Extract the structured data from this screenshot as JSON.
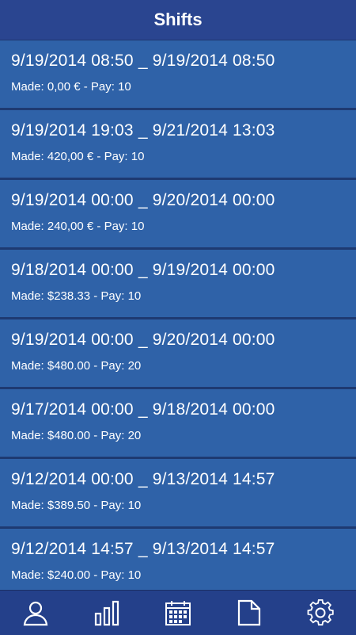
{
  "header": {
    "title": "Shifts"
  },
  "shifts": [
    {
      "range": "9/19/2014 08:50 _ 9/19/2014 08:50",
      "summary": "Made: 0,00 € - Pay: 10"
    },
    {
      "range": "9/19/2014 19:03 _ 9/21/2014 13:03",
      "summary": "Made: 420,00 € - Pay: 10"
    },
    {
      "range": "9/19/2014 00:00 _ 9/20/2014 00:00",
      "summary": "Made: 240,00 € - Pay: 10"
    },
    {
      "range": "9/18/2014 00:00 _ 9/19/2014 00:00",
      "summary": "Made: $238.33 - Pay: 10"
    },
    {
      "range": "9/19/2014 00:00 _ 9/20/2014 00:00",
      "summary": "Made: $480.00 - Pay: 20"
    },
    {
      "range": "9/17/2014 00:00 _ 9/18/2014 00:00",
      "summary": "Made: $480.00 - Pay: 20"
    },
    {
      "range": "9/12/2014 00:00 _ 9/13/2014 14:57",
      "summary": "Made: $389.50 - Pay: 10"
    },
    {
      "range": "9/12/2014 14:57 _ 9/13/2014 14:57",
      "summary": "Made: $240.00 - Pay: 10"
    }
  ],
  "tabbar": {
    "tabs": [
      {
        "icon": "profile-icon"
      },
      {
        "icon": "bar-chart-icon"
      },
      {
        "icon": "calendar-icon"
      },
      {
        "icon": "document-icon"
      },
      {
        "icon": "gear-icon"
      }
    ]
  },
  "colors": {
    "header_bg": "#2a4590",
    "item_bg": "#2f62a8",
    "separator": "#1e3a72",
    "tabbar_bg": "#24408a",
    "text": "#ffffff"
  }
}
